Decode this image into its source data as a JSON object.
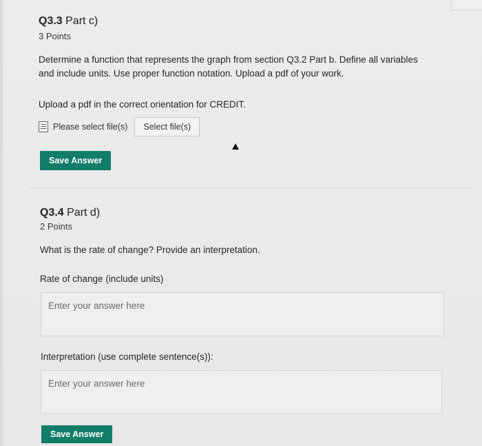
{
  "q33": {
    "title_bold": "Q3.3",
    "title_rest": " Part c)",
    "points": "3 Points",
    "prompt_line1": "Determine a function that represents the graph from section Q3.2 Part b. Define all variables",
    "prompt_line2": "and include units. Use proper function notation. Upload a pdf of your work.",
    "upload_instruction": "Upload a pdf in the correct orientation for CREDIT.",
    "file_placeholder": "Please select file(s)",
    "select_button": "Select file(s)",
    "save_button": "Save Answer"
  },
  "q34": {
    "title_bold": "Q3.4",
    "title_rest": " Part d)",
    "points": "2 Points",
    "prompt": "What is the rate of change? Provide an interpretation.",
    "field1_label": "Rate of change (include units)",
    "field1_placeholder": "Enter your answer here",
    "field2_label": "Interpretation (use complete sentence(s)):",
    "field2_placeholder": "Enter your answer here",
    "save_button": "Save Answer"
  },
  "colors": {
    "accent": "#127d68",
    "background": "#ececea"
  },
  "icons": {
    "file": "file-icon",
    "cursor": "mouse-cursor-icon"
  }
}
